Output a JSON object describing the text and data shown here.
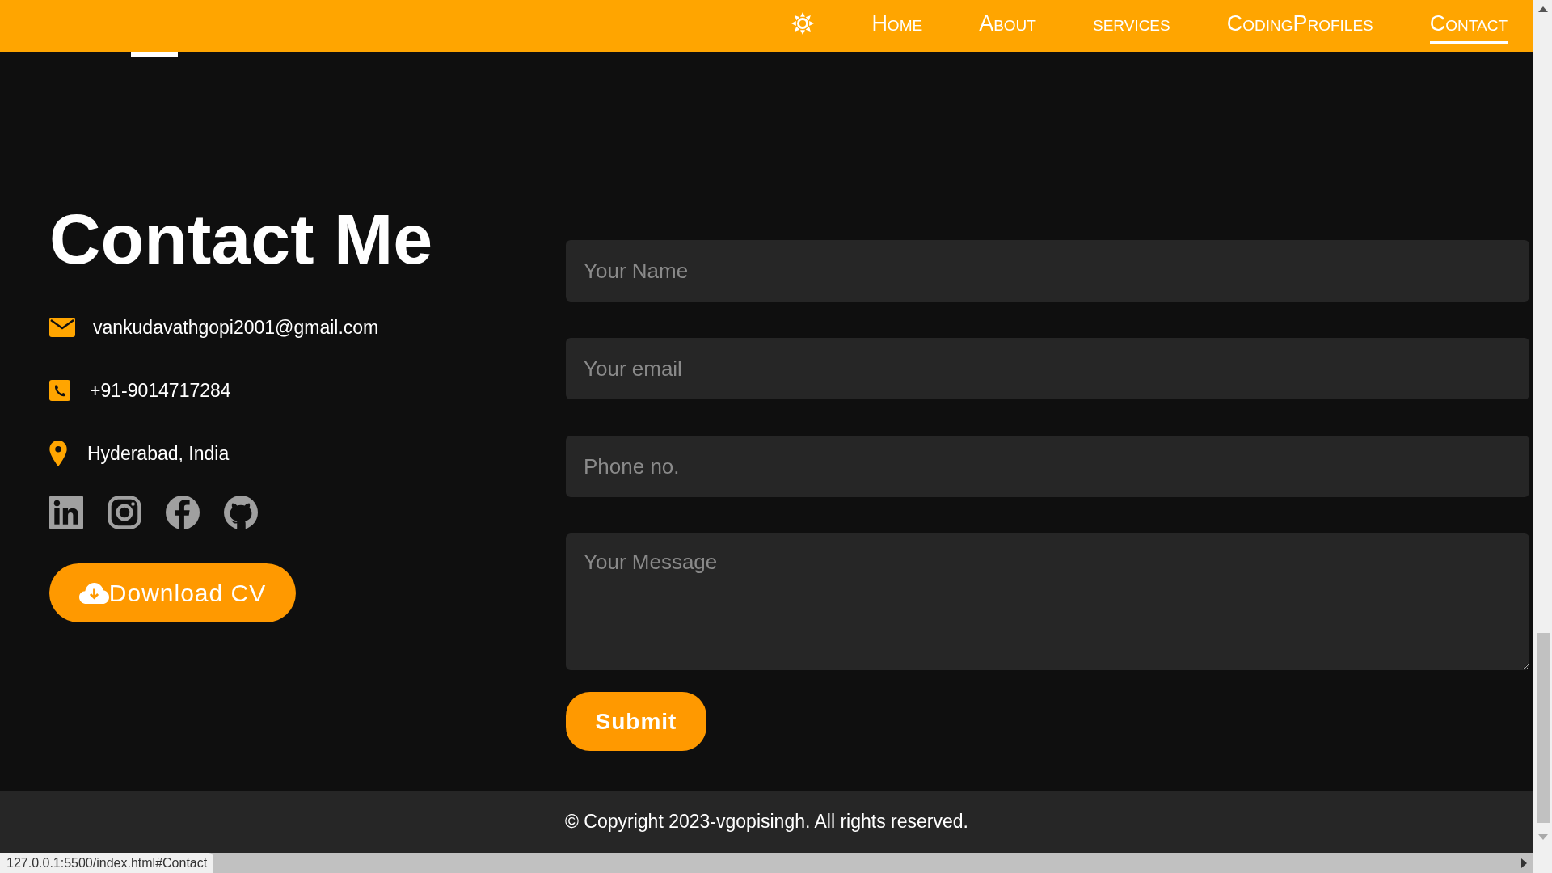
{
  "nav": {
    "items": [
      {
        "label": "Home",
        "selected": false
      },
      {
        "label": "About",
        "selected": false
      },
      {
        "label": "services",
        "selected": false
      },
      {
        "label": "CodingProfiles",
        "selected": false
      },
      {
        "label": "Contact",
        "selected": true
      }
    ]
  },
  "contact": {
    "title": "Contact Me",
    "details": [
      {
        "kind": "email",
        "text": "vankudavathgopi2001@gmail.com"
      },
      {
        "kind": "phone",
        "text": "+91-9014717284"
      },
      {
        "kind": "location",
        "text": "Hyderabad, India"
      }
    ],
    "socials": [
      {
        "kind": "linkedin"
      },
      {
        "kind": "instagram"
      },
      {
        "kind": "facebook"
      },
      {
        "kind": "github"
      }
    ],
    "download_button": "Download CV"
  },
  "form": {
    "fields": [
      {
        "kind": "input",
        "placeholder": "Your Name"
      },
      {
        "kind": "input",
        "placeholder": "Your email"
      },
      {
        "kind": "input",
        "placeholder": "Phone no."
      },
      {
        "kind": "textarea",
        "placeholder": "Your Message"
      }
    ],
    "submit": "Submit"
  },
  "footer": "© Copyright 2023-vgopisingh. All rights reserved.",
  "status_bar": "127.0.0.1:5500/index.html#Contact"
}
